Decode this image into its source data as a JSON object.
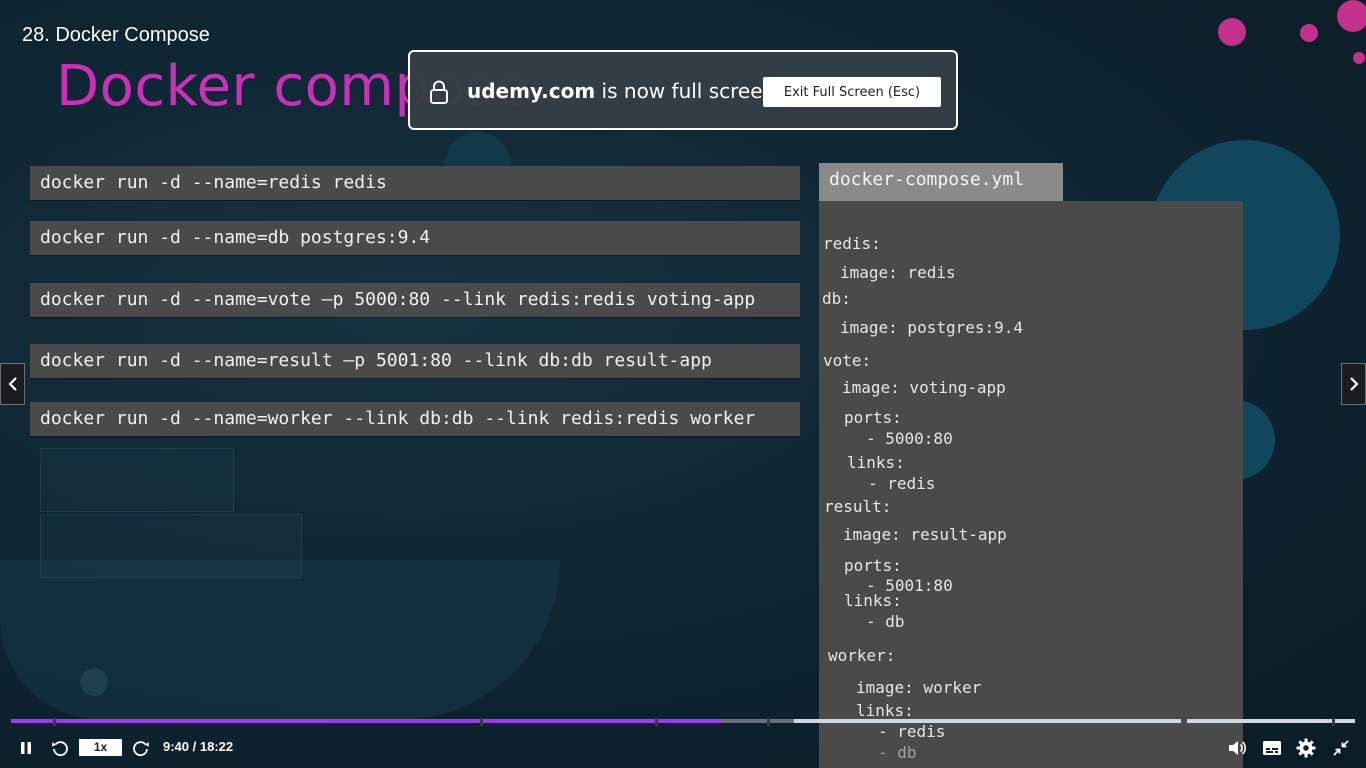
{
  "course": {
    "lecture_title": "28. Docker Compose"
  },
  "slide": {
    "heading": "Docker compose",
    "commands": [
      "docker run -d --name=redis redis",
      "docker run -d --name=db postgres:9.4",
      "docker run -d --name=vote –p 5000:80 --link redis:redis voting-app",
      "docker run -d --name=result –p 5001:80 --link db:db result-app",
      "docker run -d --name=worker --link db:db --link redis:redis worker"
    ],
    "yml_filename": "docker-compose.yml",
    "yml_lines": [
      "redis:",
      "image: redis",
      "db:",
      "image: postgres:9.4",
      "vote:",
      "image: voting-app",
      "ports:",
      "- 5000:80",
      "links:",
      "- redis",
      "result:",
      "image: result-app",
      "ports:",
      "- 5001:80",
      "links:",
      "- db",
      "worker:",
      "image: worker",
      "links:",
      "- redis",
      "- db"
    ]
  },
  "fullscreen_banner": {
    "domain": "udemy.com",
    "message": " is now full screen",
    "exit_button_label": "Exit Full Screen (Esc)"
  },
  "player": {
    "speed": "1x",
    "time": "9:40 / 18:22",
    "played_fraction": 0.528,
    "colors": {
      "played": "#a435f0",
      "track": "#d1d7dc",
      "accent_heading": "#cc2fb8"
    }
  },
  "icons": {
    "pause": "pause-icon",
    "rewind": "rewind-5-icon",
    "forward": "forward-5-icon",
    "volume": "volume-icon",
    "captions": "captions-icon",
    "settings": "gear-icon",
    "exit_fullscreen": "exit-fullscreen-icon",
    "lock": "lock-icon",
    "prev": "chevron-left-icon",
    "next": "chevron-right-icon"
  }
}
